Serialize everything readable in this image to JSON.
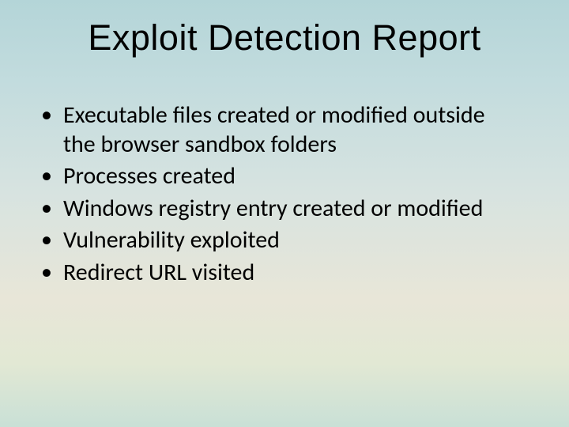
{
  "slide": {
    "title": "Exploit Detection Report",
    "bullets": [
      "Executable files created or modified outside the browser sandbox folders",
      "Processes created",
      "Windows registry entry created or modified",
      "Vulnerability exploited",
      "Redirect URL visited"
    ]
  }
}
